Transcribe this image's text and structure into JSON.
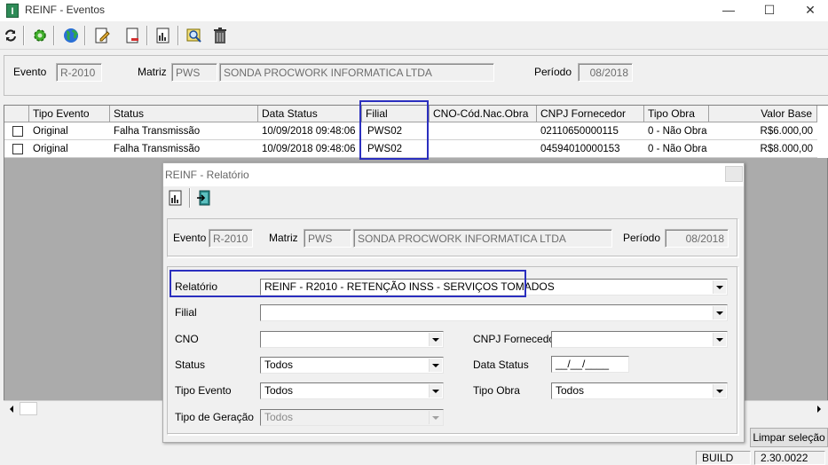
{
  "window": {
    "title": "REINF - Eventos",
    "app_icon": "I",
    "minimize_glyph": "—",
    "maximize_glyph": "☐",
    "close_glyph": "✕"
  },
  "toolbar": {
    "icons": [
      "refresh-icon",
      "gear-icon",
      "globe-icon",
      "edit-document-icon",
      "export-document-icon",
      "report-icon",
      "search-icon",
      "trash-icon"
    ]
  },
  "header": {
    "evento_label": "Evento",
    "evento_value": "R-2010",
    "matriz_label": "Matriz",
    "matriz_code": "PWS",
    "matriz_name": "SONDA PROCWORK INFORMATICA LTDA",
    "periodo_label": "Período",
    "periodo_value": "08/2018"
  },
  "grid": {
    "columns": [
      "Tipo Evento",
      "Status",
      "Data Status",
      "Filial",
      "CNO-Cód.Nac.Obra",
      "CNPJ Fornecedor",
      "Tipo Obra",
      "Valor Base"
    ],
    "rows": [
      {
        "tipo_evento": "Original",
        "status": "Falha Transmissão",
        "data_status": "10/09/2018 09:48:06",
        "filial": "PWS02",
        "cno": "",
        "cnpj": "02110650000115",
        "tipo_obra": "0 - Não Obra",
        "valor_base": "R$6.000,00"
      },
      {
        "tipo_evento": "Original",
        "status": "Falha Transmissão",
        "data_status": "10/09/2018 09:48:06",
        "filial": "PWS02",
        "cno": "",
        "cnpj": "04594010000153",
        "tipo_obra": "0 - Não Obra",
        "valor_base": "R$8.000,00"
      }
    ]
  },
  "buttons": {
    "limpar": "Limpar seleção"
  },
  "statusbar": {
    "build_label": "BUILD",
    "build_version": "2.30.0022"
  },
  "dialog": {
    "title": "REINF - Relatório",
    "evento_label": "Evento",
    "evento_value": "R-2010",
    "matriz_label": "Matriz",
    "matriz_code": "PWS",
    "matriz_name": "SONDA PROCWORK INFORMATICA LTDA",
    "periodo_label": "Período",
    "periodo_value": "08/2018",
    "relatorio_label": "Relatório",
    "relatorio_value": "REINF - R2010 - RETENÇÃO INSS - SERVIÇOS TOMADOS",
    "filial_label": "Filial",
    "filial_value": "",
    "cno_label": "CNO",
    "cno_value": "",
    "cnpj_label": "CNPJ Fornecedor",
    "cnpj_value": "",
    "status_label": "Status",
    "status_value": "Todos",
    "data_status_label": "Data Status",
    "data_status_value": "__/__/____",
    "tipo_evento_label": "Tipo Evento",
    "tipo_evento_value": "Todos",
    "tipo_obra_label": "Tipo Obra",
    "tipo_obra_value": "Todos",
    "tipo_geracao_label": "Tipo de Geração",
    "tipo_geracao_value": "Todos"
  },
  "colors": {
    "highlight_border": "#2b2fbf",
    "grid_background": "#ababab"
  }
}
